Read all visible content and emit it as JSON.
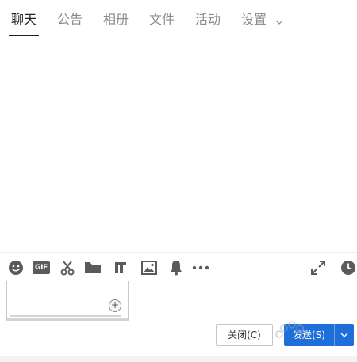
{
  "tabs": [
    {
      "label": "聊天",
      "active": true
    },
    {
      "label": "公告",
      "active": false
    },
    {
      "label": "相册",
      "active": false
    },
    {
      "label": "文件",
      "active": false
    },
    {
      "label": "活动",
      "active": false
    },
    {
      "label": "设置",
      "active": false
    }
  ],
  "toolbar": {
    "icons": [
      "emoji-icon",
      "gif-icon",
      "scissors-icon",
      "folder-icon",
      "music-note-icon",
      "image-icon",
      "bell-icon",
      "more-icon",
      "expand-icon",
      "history-clock-icon"
    ],
    "gif_text": "GIF"
  },
  "preview": {
    "zoom_glyph": "+"
  },
  "buttons": {
    "close_label": "关闭(C)",
    "send_label": "发送(S)"
  },
  "colors": {
    "accent": "#1e6fd9",
    "icon": "#5b5b5b",
    "active_tab": "#222222",
    "inactive_tab": "#8a8a8a"
  }
}
